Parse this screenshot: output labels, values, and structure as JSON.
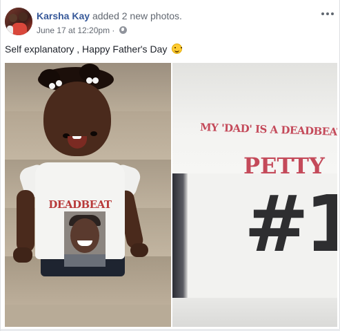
{
  "post": {
    "author": "Karsha Kay",
    "action": "added 2 new photos.",
    "date": "June 17 at 12:20pm",
    "separator": "·",
    "privacy_icon": "globe-icon",
    "more_icon": "more-options-icon",
    "caption": "Self explanatory , Happy Father's Day",
    "caption_emoji": "smiling-face-icon"
  },
  "photos": [
    {
      "shirt_text": "DEADBEAT"
    },
    {
      "shirt_line1": "MY 'DAD' IS A DEADBEAT B**",
      "shirt_line2": "PETTY",
      "shirt_number": "#1"
    }
  ],
  "colors": {
    "author_link": "#365899",
    "meta_text": "#616770",
    "body_text": "#1d2129",
    "shirt_print": "#c44a5a"
  }
}
